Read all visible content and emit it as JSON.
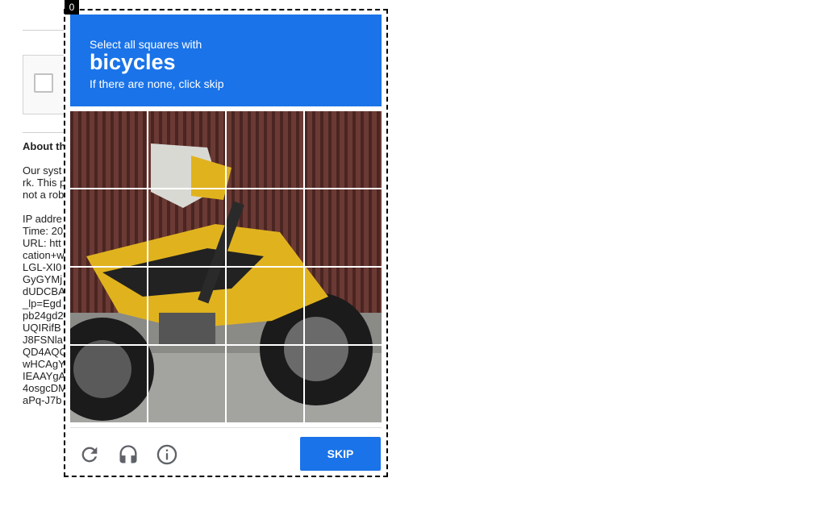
{
  "background": {
    "about_heading": "About th",
    "paragraph_lines": [
      "Our syst",
      "rk. This p",
      "not a rob"
    ],
    "info_lines": [
      "IP addre",
      "Time: 20",
      "URL: htt",
      "cation+w",
      "LGL-XI0",
      "GyGYMj",
      "dUDCBA",
      "_lp=Egd",
      "pb24gd2",
      "UQIRifB",
      "J8FSNla",
      "QD4AQC",
      "wHCAgY",
      "IEAAYgA",
      "4osgcDM",
      "aPq-J7b"
    ]
  },
  "challenge": {
    "badge": "0",
    "instruction": "Select all squares with",
    "target": "bicycles",
    "note": "If there are none, click skip",
    "tiles_count": 16,
    "buttons": {
      "reload_icon": "reload-icon",
      "audio_icon": "headphones-icon",
      "info_icon": "info-icon",
      "skip_label": "SKIP"
    }
  },
  "colors": {
    "accent": "#1a73e8"
  }
}
